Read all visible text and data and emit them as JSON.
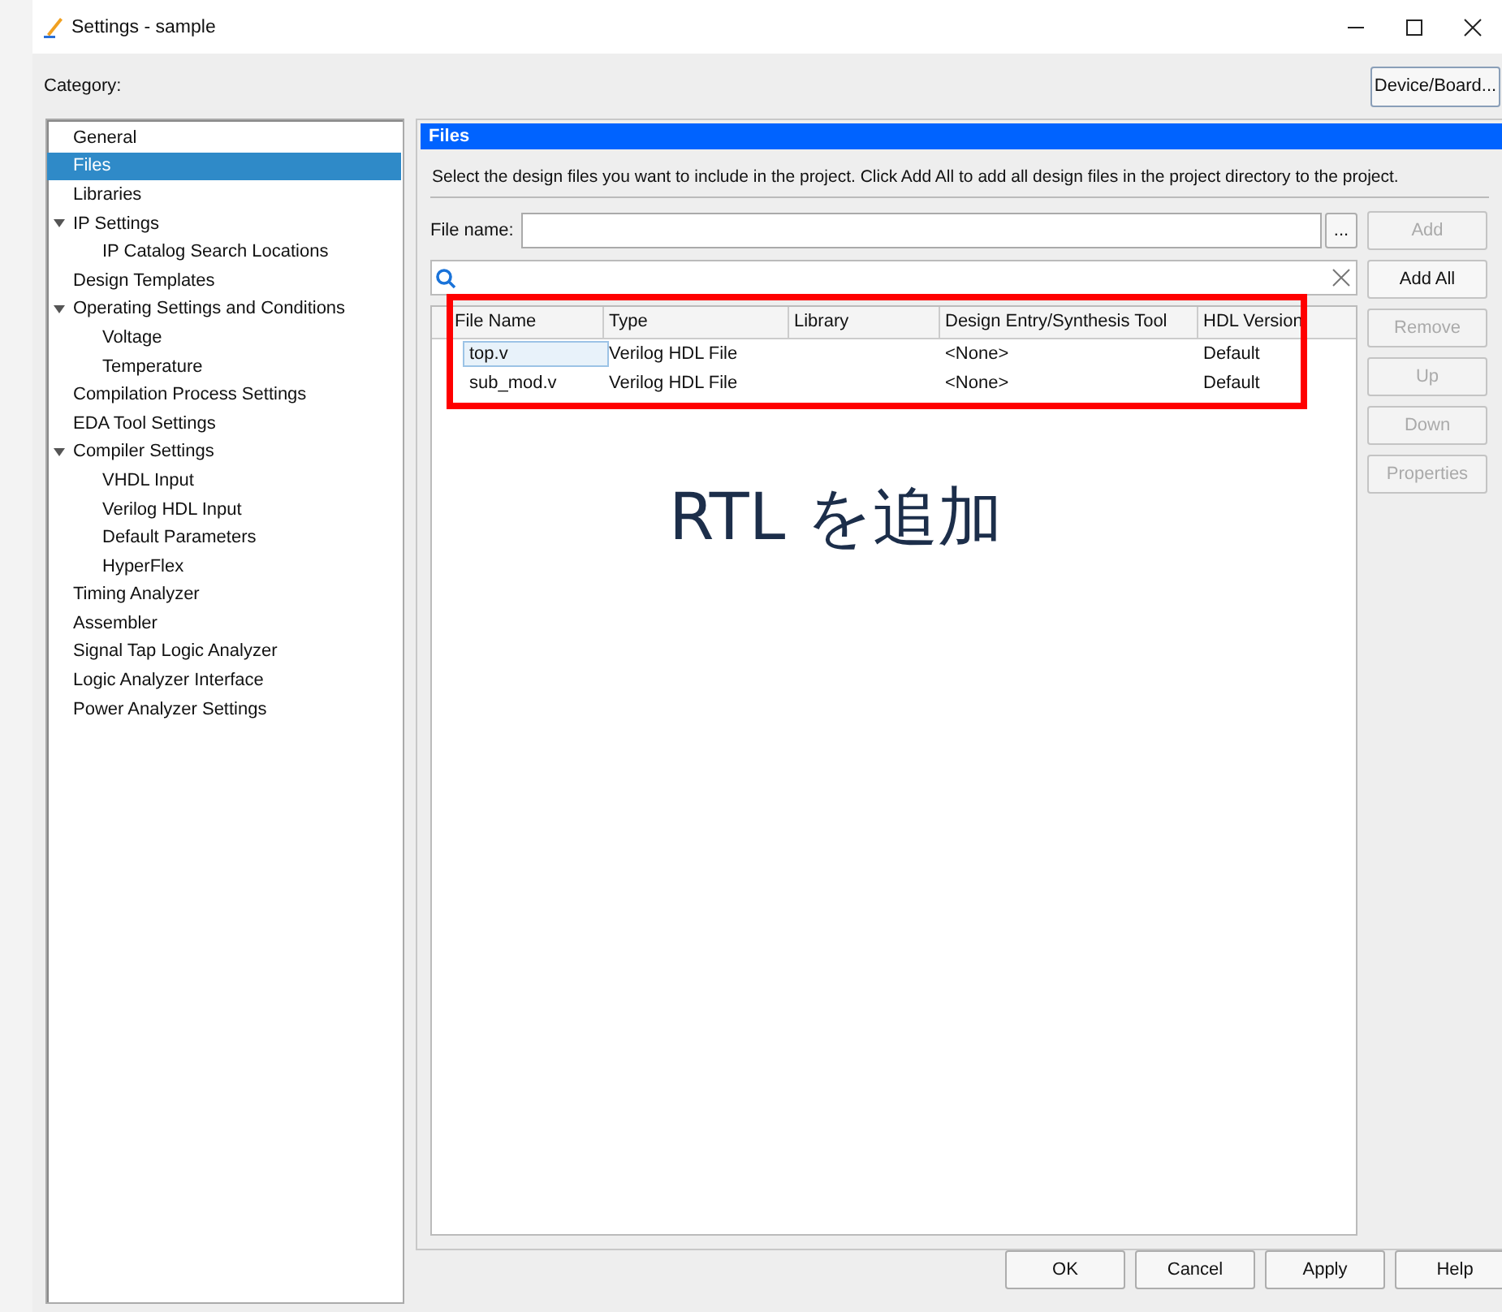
{
  "window": {
    "title": "Settings - sample"
  },
  "category_label": "Category:",
  "device_button": "Device/Board...",
  "tree": [
    {
      "label": "General",
      "selected": false
    },
    {
      "label": "Files",
      "selected": true
    },
    {
      "label": "Libraries",
      "selected": false
    },
    {
      "label": "IP Settings",
      "selected": false,
      "expanded": true,
      "children": [
        {
          "label": "IP Catalog Search Locations",
          "selected": false
        }
      ]
    },
    {
      "label": "Design Templates",
      "selected": false
    },
    {
      "label": "Operating Settings and Conditions",
      "selected": false,
      "expanded": true,
      "children": [
        {
          "label": "Voltage",
          "selected": false
        },
        {
          "label": "Temperature",
          "selected": false
        }
      ]
    },
    {
      "label": "Compilation Process Settings",
      "selected": false
    },
    {
      "label": "EDA Tool Settings",
      "selected": false
    },
    {
      "label": "Compiler Settings",
      "selected": false,
      "expanded": true,
      "children": [
        {
          "label": "VHDL Input",
          "selected": false
        },
        {
          "label": "Verilog HDL Input",
          "selected": false
        },
        {
          "label": "Default Parameters",
          "selected": false
        },
        {
          "label": "HyperFlex",
          "selected": false
        }
      ]
    },
    {
      "label": "Timing Analyzer",
      "selected": false
    },
    {
      "label": "Assembler",
      "selected": false
    },
    {
      "label": "Signal Tap Logic Analyzer",
      "selected": false
    },
    {
      "label": "Logic Analyzer Interface",
      "selected": false
    },
    {
      "label": "Power Analyzer Settings",
      "selected": false
    }
  ],
  "panel": {
    "title": "Files",
    "description": "Select the design files you want to include in the project. Click Add All to add all design files in the project directory to the project.",
    "file_name_label": "File name:",
    "browse_button": "...",
    "side_buttons": [
      {
        "label": "Add",
        "disabled": true
      },
      {
        "label": "Add All",
        "disabled": false
      },
      {
        "label": "Remove",
        "disabled": true
      },
      {
        "label": "Up",
        "disabled": true
      },
      {
        "label": "Down",
        "disabled": true
      },
      {
        "label": "Properties",
        "disabled": true
      }
    ],
    "table": {
      "columns": [
        "File Name",
        "Type",
        "Library",
        "Design Entry/Synthesis Tool",
        "HDL Version"
      ],
      "rows": [
        {
          "cells": [
            "top.v",
            "Verilog HDL File",
            "",
            "<None>",
            "Default"
          ],
          "selected": true
        },
        {
          "cells": [
            "sub_mod.v",
            "Verilog HDL File",
            "",
            "<None>",
            "Default"
          ],
          "selected": false
        }
      ]
    }
  },
  "annotation": {
    "text": "RTL を追加"
  },
  "footer_buttons": [
    "OK",
    "Cancel",
    "Apply",
    "Help"
  ]
}
